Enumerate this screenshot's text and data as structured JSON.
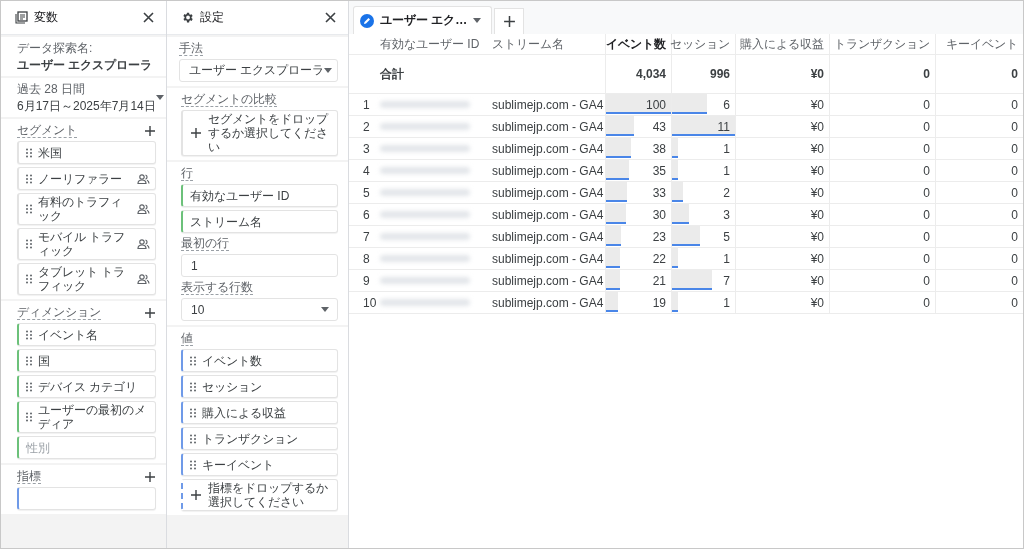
{
  "variables_panel": {
    "title": "変数",
    "exploration_name_label": "データ探索名:",
    "exploration_name": "ユーザー エクスプローラ",
    "date_range": {
      "label": "過去 28 日間",
      "value": "6月17日～2025年7月14日"
    },
    "segments": {
      "title": "セグメント",
      "items": [
        {
          "label": "米国",
          "user_scope": false
        },
        {
          "label": "ノーリファラー",
          "user_scope": true
        },
        {
          "label": "有料のトラフィック",
          "user_scope": true
        },
        {
          "label": "モバイル トラフィック",
          "user_scope": true
        },
        {
          "label": "タブレット トラフィック",
          "user_scope": true
        }
      ]
    },
    "dimensions": {
      "title": "ディメンション",
      "items": [
        {
          "label": "イベント名",
          "disabled": false
        },
        {
          "label": "国",
          "disabled": false
        },
        {
          "label": "デバイス カテゴリ",
          "disabled": false
        },
        {
          "label": "ユーザーの最初のメディア",
          "disabled": false
        },
        {
          "label": "性別",
          "disabled": true
        }
      ]
    },
    "metrics": {
      "title": "指標"
    }
  },
  "settings_panel": {
    "title": "設定",
    "technique": {
      "label": "手法",
      "value": "ユーザー エクスプローラ"
    },
    "segment_comparison": {
      "label": "セグメントの比較",
      "placeholder": "セグメントをドロップするか選択してください"
    },
    "rows": {
      "label": "行",
      "items": [
        "有効なユーザー ID",
        "ストリーム名"
      ]
    },
    "first_row": {
      "label": "最初の行",
      "value": "1"
    },
    "rows_to_show": {
      "label": "表示する行数",
      "value": "10"
    },
    "values": {
      "label": "値",
      "items": [
        "イベント数",
        "セッション",
        "購入による収益",
        "トランザクション",
        "キーイベント"
      ],
      "placeholder": "指標をドロップするか選択してください"
    }
  },
  "tabs": [
    {
      "label": "ユーザー エク…",
      "selected": true
    }
  ],
  "table": {
    "columns": [
      {
        "label": "有効なユーザー ID",
        "sorted": false
      },
      {
        "label": "ストリーム名",
        "sorted": false
      },
      {
        "label": "イベント数",
        "sorted": true
      },
      {
        "label": "セッション",
        "sorted": false
      },
      {
        "label": "購入による収益",
        "sorted": false
      },
      {
        "label": "トランザクション",
        "sorted": false
      },
      {
        "label": "キーイベント",
        "sorted": false
      }
    ],
    "total": {
      "label": "合計",
      "values": [
        "4,034",
        "996",
        "¥0",
        "0",
        "0"
      ]
    },
    "rows": [
      {
        "index": "1",
        "stream": "sublimejp.com - GA4",
        "events": "100",
        "events_bar": {
          "level": 1
        },
        "sessions": "6",
        "sessions_bar": {
          "level": 0.55
        },
        "revenue": "¥0",
        "transactions": "0",
        "key_events": "0"
      },
      {
        "index": "2",
        "stream": "sublimejp.com - GA4",
        "events": "43",
        "events_bar": {
          "level": 0.43
        },
        "sessions": "11",
        "sessions_bar": {
          "level": 1
        },
        "revenue": "¥0",
        "transactions": "0",
        "key_events": "0"
      },
      {
        "index": "3",
        "stream": "sublimejp.com - GA4",
        "events": "38",
        "events_bar": {
          "level": 0.38
        },
        "sessions": "1",
        "sessions_bar": {
          "level": 0.09
        },
        "revenue": "¥0",
        "transactions": "0",
        "key_events": "0"
      },
      {
        "index": "4",
        "stream": "sublimejp.com - GA4",
        "events": "35",
        "events_bar": {
          "level": 0.35
        },
        "sessions": "1",
        "sessions_bar": {
          "level": 0.09
        },
        "revenue": "¥0",
        "transactions": "0",
        "key_events": "0"
      },
      {
        "index": "5",
        "stream": "sublimejp.com - GA4",
        "events": "33",
        "events_bar": {
          "level": 0.33
        },
        "sessions": "2",
        "sessions_bar": {
          "level": 0.18
        },
        "revenue": "¥0",
        "transactions": "0",
        "key_events": "0"
      },
      {
        "index": "6",
        "stream": "sublimejp.com - GA4",
        "events": "30",
        "events_bar": {
          "level": 0.3
        },
        "sessions": "3",
        "sessions_bar": {
          "level": 0.27
        },
        "revenue": "¥0",
        "transactions": "0",
        "key_events": "0"
      },
      {
        "index": "7",
        "stream": "sublimejp.com - GA4",
        "events": "23",
        "events_bar": {
          "level": 0.23
        },
        "sessions": "5",
        "sessions_bar": {
          "level": 0.45
        },
        "revenue": "¥0",
        "transactions": "0",
        "key_events": "0"
      },
      {
        "index": "8",
        "stream": "sublimejp.com - GA4",
        "events": "22",
        "events_bar": {
          "level": 0.22
        },
        "sessions": "1",
        "sessions_bar": {
          "level": 0.09
        },
        "revenue": "¥0",
        "transactions": "0",
        "key_events": "0"
      },
      {
        "index": "9",
        "stream": "sublimejp.com - GA4",
        "events": "21",
        "events_bar": {
          "level": 0.21
        },
        "sessions": "7",
        "sessions_bar": {
          "level": 0.64
        },
        "revenue": "¥0",
        "transactions": "0",
        "key_events": "0"
      },
      {
        "index": "10",
        "stream": "sublimejp.com - GA4",
        "events": "19",
        "events_bar": {
          "level": 0.19
        },
        "sessions": "1",
        "sessions_bar": {
          "level": 0.09
        },
        "revenue": "¥0",
        "transactions": "0",
        "key_events": "0"
      }
    ]
  }
}
